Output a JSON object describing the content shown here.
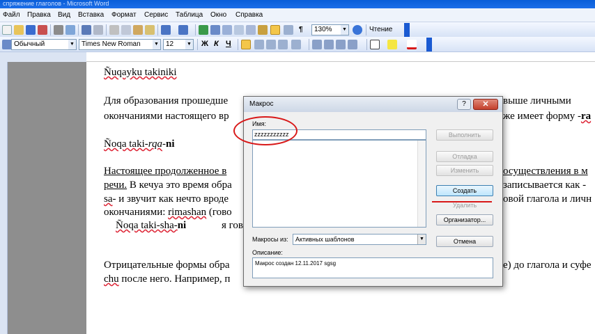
{
  "window": {
    "title": "спряжение глаголов - Microsoft Word"
  },
  "menu": [
    "Файл",
    "Правка",
    "Вид",
    "Вставка",
    "Формат",
    "Сервис",
    "Таблица",
    "Окно",
    "Справка"
  ],
  "toolbar": {
    "zoom": "130%",
    "reading_label": "Чтение"
  },
  "format_bar": {
    "style": "Обычный",
    "font": "Times New Roman",
    "size": "12",
    "bold": "Ж",
    "italic": "К",
    "underline": "Ч"
  },
  "document": {
    "line1": "Ñuqayku takiniki",
    "line2_a": "Для образования прошедше",
    "line2_b": "выше личными",
    "line3_a": "окончаниями настоящего вр",
    "line3_b": "же имеет форму -",
    "line3_c": "ra",
    "line4_a": "Ñoqa  taki-",
    "line4_b": "rqa",
    "line4_c": "-",
    "line4_d": "ni",
    "line5_a": "Настоящее продолженное в",
    "line5_b": "осуществления в м",
    "line6_a": "речи.",
    "line6_b": " В кечуа это время обра",
    "line6_c": "записывается как -",
    "line7_a": "sa",
    "line7_b": "- и звучит как нечто вроде",
    "line7_c": "овой глагола и личн",
    "line8_a": "окончаниями: ",
    "line8_b": "rimashan",
    "line8_c": " (гово",
    "line9_a": "Ñoqa  taki-sha-",
    "line9_b": "ni",
    "line9_c": "я говор",
    "line10_a": "Отрицательные формы обра",
    "line10_b": "е) до глагола и суфе",
    "line11_a": "chu",
    "line11_b": " после него. Например, п"
  },
  "dialog": {
    "title": "Макрос",
    "help": "?",
    "close": "✕",
    "name_label": "Имя:",
    "name_value": "zzzzzzzzzzz",
    "buttons": [
      "Выполнить",
      "Отладка",
      "Изменить",
      "Создать",
      "Удалить",
      "Организатор...",
      "Отмена"
    ],
    "macros_from_label": "Макросы из:",
    "macros_from_value": "Активных шаблонов",
    "description_label": "Описание:",
    "description_value": "Макрос создан 12.11.2017 sgsg"
  },
  "colors": {
    "annotation_red": "#d81818",
    "titlebar_blue": "#0a5ed8"
  }
}
